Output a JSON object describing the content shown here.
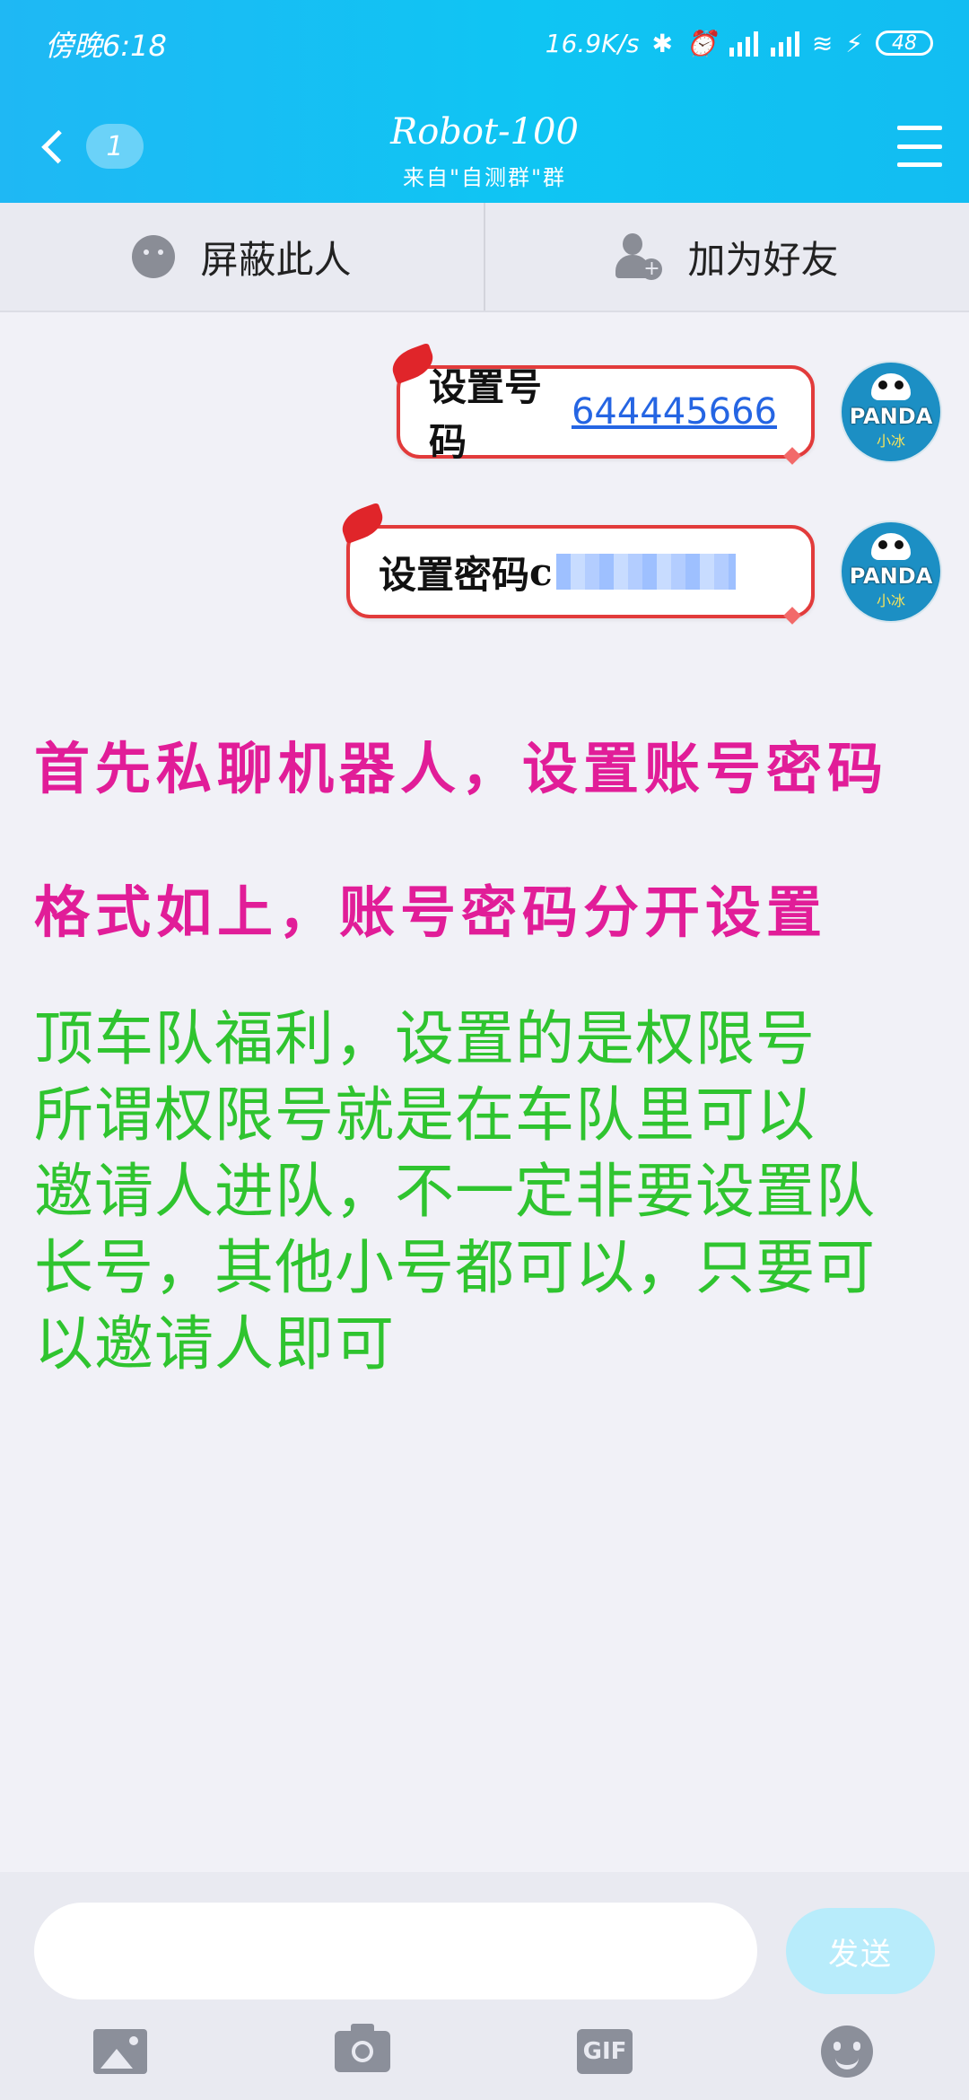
{
  "status_bar": {
    "time": "傍晚6:18",
    "network_speed": "16.9K/s",
    "battery": "48"
  },
  "header": {
    "unread_count": "1",
    "title": "Robot-100",
    "subtitle": "来自\"自测群\"群"
  },
  "actions": {
    "block_label": "屏蔽此人",
    "add_friend_label": "加为好友"
  },
  "messages": [
    {
      "prefix": "设置号码",
      "link": "644445666"
    },
    {
      "prefix": "设置密码",
      "visible_suffix": "c"
    }
  ],
  "notes": {
    "pink_line1": "首先私聊机器人，设置账号密码",
    "pink_line2": "格式如上，账号密码分开设置",
    "green_lines": [
      "顶车队福利，设置的是权限号",
      "所谓权限号就是在车队里可以",
      "邀请人进队，不一定非要设置队",
      "长号，其他小号都可以，只要可",
      "以邀请人即可"
    ]
  },
  "avatar": {
    "label": "PANDA",
    "sub": "小冰"
  },
  "composer": {
    "send_label": "发送",
    "gif_label": "GIF"
  },
  "colors": {
    "header_bg": "#1fb8f4",
    "bubble_border": "#e23b3b",
    "link": "#2565e3",
    "note_pink": "#e11d98",
    "note_green": "#2fc42f",
    "send_btn": "#b8ecfb"
  }
}
